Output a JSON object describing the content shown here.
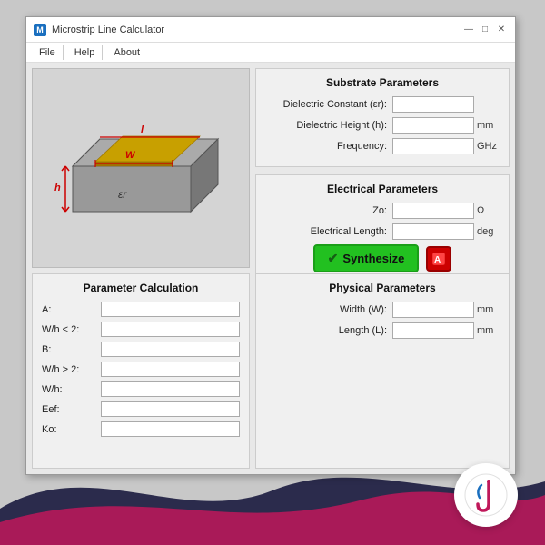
{
  "window": {
    "title": "Microstrip Line Calculator",
    "icon": "M"
  },
  "title_bar": {
    "min_label": "—",
    "max_label": "□",
    "close_label": "✕"
  },
  "menu": {
    "items": [
      "File",
      "Help",
      "About"
    ]
  },
  "substrate": {
    "title": "Substrate Parameters",
    "fields": [
      {
        "label": "Dielectric Constant (εr):",
        "unit": ""
      },
      {
        "label": "Dielectric Height (h):",
        "unit": "mm"
      },
      {
        "label": "Frequency:",
        "unit": "GHz"
      }
    ]
  },
  "electrical": {
    "title": "Electrical Parameters",
    "fields": [
      {
        "label": "Zo:",
        "unit": "Ω"
      },
      {
        "label": "Electrical Length:",
        "unit": "deg"
      }
    ]
  },
  "synthesize_btn": "Synthesize",
  "param_calc": {
    "title": "Parameter Calculation",
    "rows": [
      {
        "label": "A:"
      },
      {
        "label": "W/h < 2:"
      },
      {
        "label": "B:"
      },
      {
        "label": "W/h > 2:"
      },
      {
        "label": "W/h:"
      },
      {
        "label": "Eef:"
      },
      {
        "label": "Ko:"
      }
    ]
  },
  "physical": {
    "title": "Physical Parameters",
    "fields": [
      {
        "label": "Width (W):",
        "unit": "mm"
      },
      {
        "label": "Length (L):",
        "unit": "mm"
      }
    ]
  },
  "diagram_labels": {
    "h": "h",
    "w": "W",
    "l": "l",
    "er": "εr"
  }
}
